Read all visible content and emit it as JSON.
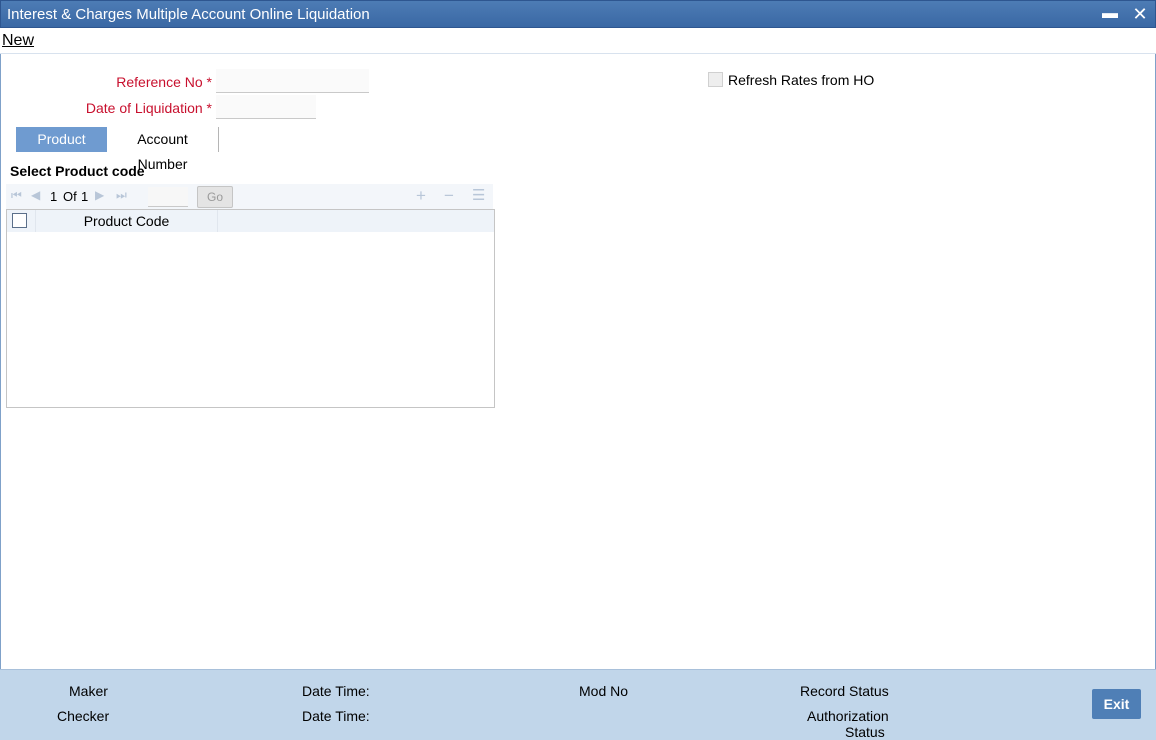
{
  "window": {
    "title": "Interest & Charges Multiple Account Online Liquidation",
    "minimize_icon": "minimize-icon",
    "close_icon": "close-icon"
  },
  "menu": {
    "new_label": "New"
  },
  "form": {
    "reference_no_label": "Reference No",
    "reference_no_value": "",
    "date_label": "Date of Liquidation",
    "date_value": "",
    "required_mark": "*",
    "refresh_rates_label": "Refresh Rates from HO",
    "refresh_rates_checked": false
  },
  "tabs": [
    {
      "label": "Product Code",
      "active": true
    },
    {
      "label": "Account Number",
      "active": false
    }
  ],
  "grid": {
    "section_title": "Select Product code",
    "page_current": "1",
    "page_of": "Of",
    "page_total": "1",
    "go_label": "Go",
    "columns": [
      "Product Code"
    ],
    "rows": []
  },
  "footer": {
    "maker_label": "Maker",
    "checker_label": "Checker",
    "date_time_label": "Date Time:",
    "mod_no_label": "Mod No",
    "record_status_label": "Record Status",
    "auth_status_line1": "Authorization",
    "auth_status_line2": "Status",
    "exit_label": "Exit"
  },
  "colors": {
    "titlebar": "#3f6da9",
    "required_label": "#c8102e",
    "tab_active": "#6f9bd0",
    "footer": "#c1d6ea",
    "exit_button": "#4f7fb6"
  }
}
